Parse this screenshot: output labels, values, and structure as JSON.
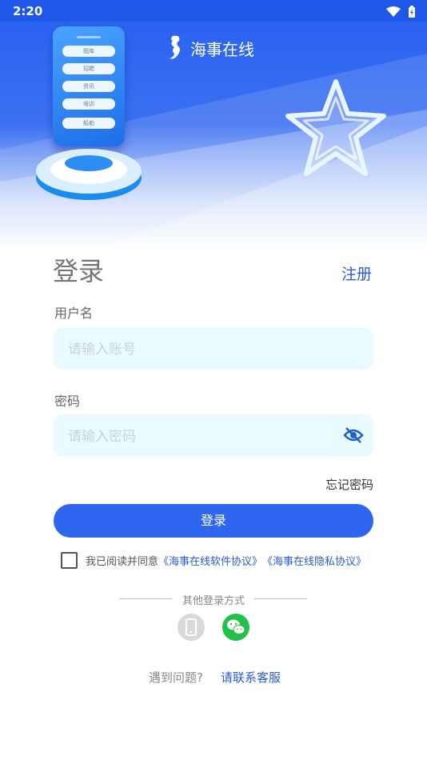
{
  "status_bar": {
    "time": "2:20"
  },
  "brand": {
    "name": "海事在线"
  },
  "phone_menu": [
    "题库",
    "招聘",
    "资讯",
    "培训",
    "船舶"
  ],
  "login": {
    "title": "登录",
    "register_label": "注册",
    "username_label": "用户名",
    "username_placeholder": "请输入账号",
    "password_label": "密码",
    "password_placeholder": "请输入密码",
    "forgot_label": "忘记密码",
    "submit_label": "登录"
  },
  "agreement": {
    "prefix": "我已阅读并同意",
    "software_link": "《海事在线软件协议》",
    "privacy_link": "《海事在线隐私协议》"
  },
  "other_login": {
    "label": "其他登录方式"
  },
  "help": {
    "question": "遇到问题?",
    "contact_link": "请联系客服"
  },
  "colors": {
    "primary": "#2f66ef",
    "wechat": "#21c24a",
    "field_bg": "#eafbff"
  }
}
